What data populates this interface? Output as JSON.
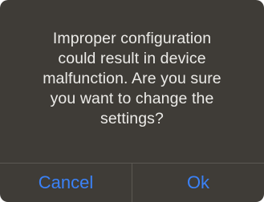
{
  "dialog": {
    "message": "Improper configuration\ncould result in device\nmalfunction. Are you sure\nyou want to change the\nsettings?",
    "buttons": {
      "cancel_label": "Cancel",
      "ok_label": "Ok"
    }
  },
  "colors": {
    "dialog_background": "#3f3c37",
    "message_text": "#ecebe8",
    "button_text": "#3b82f7",
    "divider": "#5b5852"
  }
}
